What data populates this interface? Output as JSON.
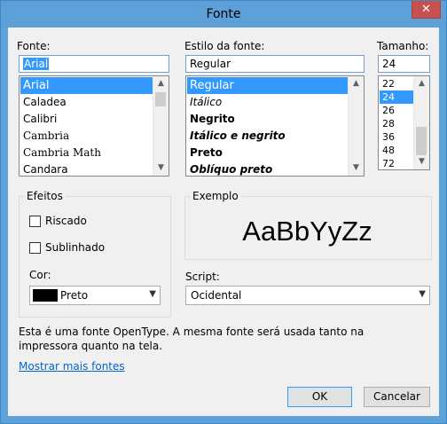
{
  "window": {
    "title": "Fonte",
    "close_glyph": "✕"
  },
  "font": {
    "label": "Fonte:",
    "value": "Arial",
    "items": [
      "Arial",
      "Caladea",
      "Calibri",
      "Cambria",
      "Cambria Math",
      "Candara"
    ],
    "selected_index": 0
  },
  "style": {
    "label": "Estilo da fonte:",
    "value": "Regular",
    "items": [
      "Regular",
      "Itálico",
      "Negrito",
      "Itálico e negrito",
      "Preto",
      "Oblíquo preto"
    ],
    "selected_index": 0
  },
  "size": {
    "label": "Tamanho:",
    "value": "24",
    "items": [
      "22",
      "24",
      "26",
      "28",
      "36",
      "48",
      "72"
    ],
    "selected_index": 1
  },
  "effects": {
    "group_label": "Efeitos",
    "strikeout_label": "Riscado",
    "strikeout_checked": false,
    "underline_label": "Sublinhado",
    "underline_checked": false,
    "color_label": "Cor:",
    "color_value": "Preto",
    "color_hex": "#000000"
  },
  "sample": {
    "group_label": "Exemplo",
    "text": "AaBbYyZz"
  },
  "script": {
    "label": "Script:",
    "value": "Ocidental"
  },
  "info_text_line1": "Esta é uma fonte OpenType. A mesma fonte será usada tanto na",
  "info_text_line2": "impressora quanto na tela.",
  "more_fonts_link": "Mostrar mais fontes",
  "buttons": {
    "ok": "OK",
    "cancel": "Cancelar"
  }
}
